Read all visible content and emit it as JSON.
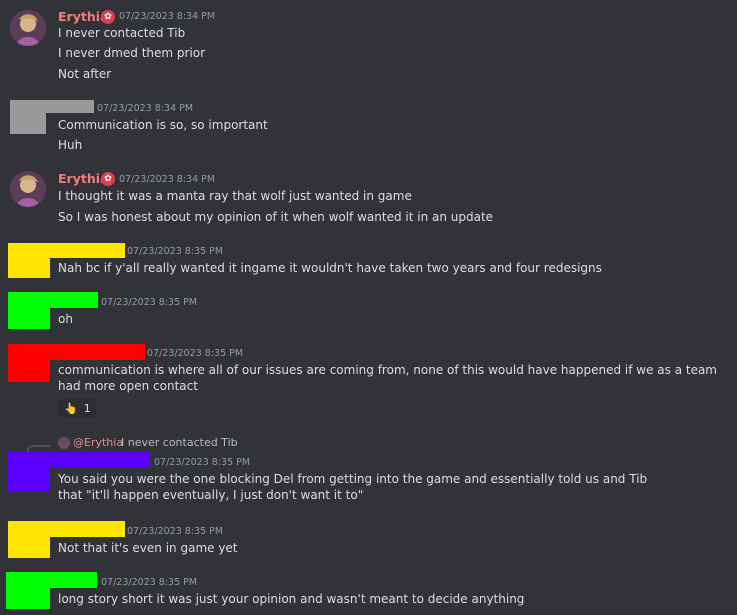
{
  "colors": {
    "background": "#313338",
    "text": "#dbdee1",
    "timestamp": "#949ba4",
    "username_pink": "#f47b7b",
    "redact_gray": "#9a9a9a",
    "redact_yellow": "#ffe600",
    "redact_green": "#00ff00",
    "redact_red": "#ff0000",
    "redact_blue": "#5a00ff"
  },
  "messages": [
    {
      "username": "Erythia",
      "timestamp": "07/23/2023 8:34 PM",
      "lines": [
        "I never contacted Tib",
        "I never dmed them prior",
        "Not after"
      ]
    },
    {
      "username": "",
      "timestamp": "07/23/2023 8:34 PM",
      "lines": [
        "Communication is so, so important",
        "Huh"
      ]
    },
    {
      "username": "Erythia",
      "timestamp": "07/23/2023 8:34 PM",
      "lines": [
        "I thought it was a manta ray that wolf just wanted in game",
        "So I was honest about my opinion of it when wolf wanted it in an update"
      ]
    },
    {
      "username": "",
      "timestamp": "07/23/2023 8:35 PM",
      "lines": [
        "Nah bc if y'all really wanted it ingame it wouldn't have taken two years and four redesigns"
      ]
    },
    {
      "username": "",
      "timestamp": "07/23/2023 8:35 PM",
      "lines": [
        "oh"
      ]
    },
    {
      "username": "",
      "timestamp": "07/23/2023 8:35 PM",
      "lines": [
        "communication is where all of our issues are coming from, none of this would have happened if we as a team had more open contact"
      ],
      "reaction": {
        "emoji": "👆",
        "count": "1"
      }
    },
    {
      "reply": {
        "mention": "@Erythia",
        "text": "I never contacted Tib"
      },
      "username": "",
      "timestamp": "07/23/2023 8:35 PM",
      "lines": [
        "You said you were the one blocking Del from getting into the game and essentially told us and Tib that \"it'll happen eventually, I just don't want it to\""
      ]
    },
    {
      "username": "",
      "timestamp": "07/23/2023 8:35 PM",
      "lines": [
        "Not that it's even in game yet"
      ]
    },
    {
      "username": "",
      "timestamp": "07/23/2023 8:35 PM",
      "lines": [
        "long story short it was just your opinion and wasn't meant to decide anything"
      ]
    }
  ]
}
